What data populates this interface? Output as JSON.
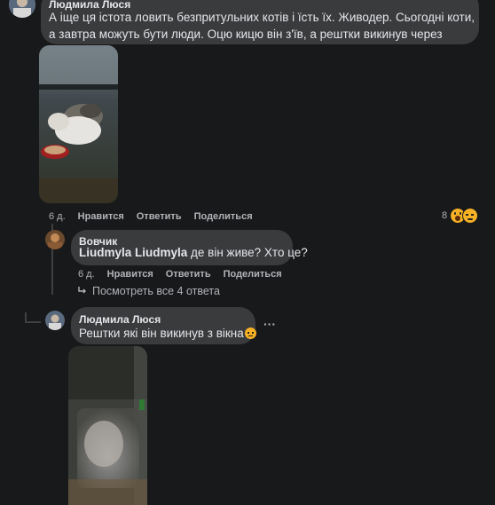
{
  "comment1": {
    "author": "Людмила Люся",
    "text": "А іще ця істота ловить безпритульних котів і їсть їх. Живодер. Сьогодні коти, а завтра можуть бути люди. Оцю кицю він з'їв, а рештки викинув через вікно.",
    "time": "6 д.",
    "like": "Нравится",
    "reply": "Ответить",
    "share": "Поделиться",
    "reactions_count": "8"
  },
  "reply1": {
    "author": "Вовчик",
    "mention": "Liudmyla Liudmyla",
    "text": " де він живе? Хто це?",
    "time": "6 д.",
    "like": "Нравится",
    "reply": "Ответить",
    "share": "Поделиться"
  },
  "view_replies": {
    "label": "Посмотреть все 4 ответа"
  },
  "reply2": {
    "author": "Людмила Люся",
    "text": "Рештки які він викинув з вікна",
    "emoji": "😞",
    "more": "···"
  },
  "colors": {
    "background": "#18191a",
    "bubble": "#3a3b3c",
    "text": "#e4e6eb",
    "secondary": "#b0b3b8"
  }
}
